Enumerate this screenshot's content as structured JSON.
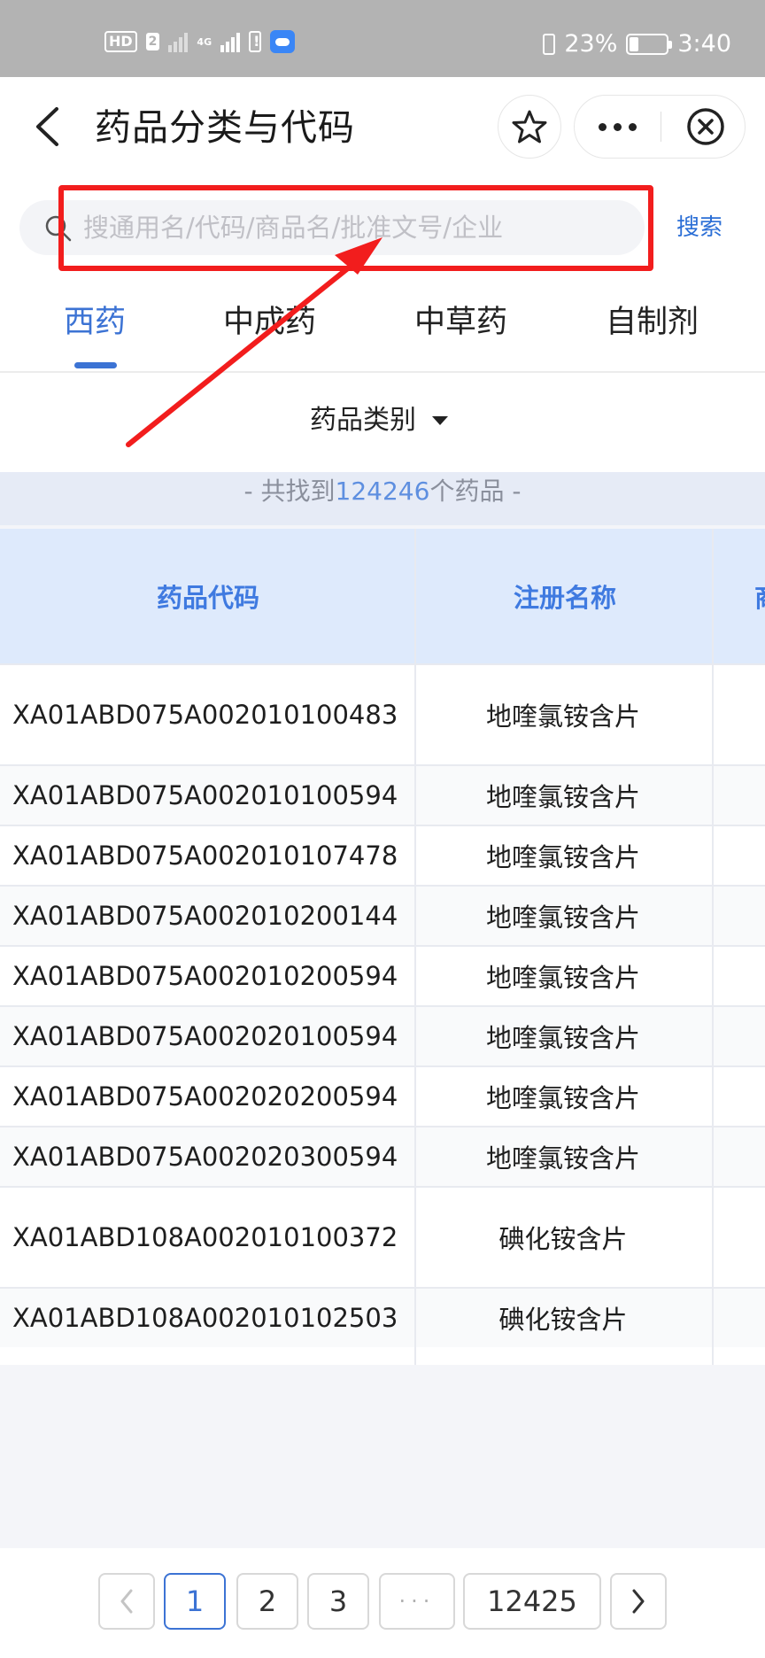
{
  "status_bar": {
    "hd": "HD",
    "sim": "2",
    "network": "4G",
    "battery_percent": "23%",
    "battery_level": 0.23,
    "time": "3:40"
  },
  "header": {
    "title": "药品分类与代码",
    "star_icon": "star-icon",
    "more_icon": "more-dots-icon",
    "close_icon": "close-circle-icon"
  },
  "search": {
    "placeholder": "搜通用名/代码/商品名/批准文号/企业",
    "value": "",
    "button_label": "搜索"
  },
  "tabs": [
    {
      "label": "西药",
      "active": true
    },
    {
      "label": "中成药",
      "active": false
    },
    {
      "label": "中草药",
      "active": false
    },
    {
      "label": "自制剂",
      "active": false
    }
  ],
  "filter": {
    "label": "药品类别"
  },
  "result_count": {
    "prefix": "- 共找到",
    "number": "124246",
    "suffix": "个药品 -"
  },
  "table": {
    "headers": [
      "药品代码",
      "注册名称",
      "商"
    ],
    "rows": [
      {
        "code": "XA01ABD075A002010100483",
        "name": "地喹氯铵含片"
      },
      {
        "code": "XA01ABD075A002010100594",
        "name": "地喹氯铵含片"
      },
      {
        "code": "XA01ABD075A002010107478",
        "name": "地喹氯铵含片"
      },
      {
        "code": "XA01ABD075A002010200144",
        "name": "地喹氯铵含片"
      },
      {
        "code": "XA01ABD075A002010200594",
        "name": "地喹氯铵含片"
      },
      {
        "code": "XA01ABD075A002020100594",
        "name": "地喹氯铵含片"
      },
      {
        "code": "XA01ABD075A002020200594",
        "name": "地喹氯铵含片"
      },
      {
        "code": "XA01ABD075A002020300594",
        "name": "地喹氯铵含片"
      },
      {
        "code": "XA01ABD108A002010100372",
        "name": "碘化铵含片"
      },
      {
        "code": "XA01ABD108A002010102503",
        "name": "碘化铵含片"
      }
    ]
  },
  "pagination": {
    "prev_icon": "chevron-left-icon",
    "pages": [
      "1",
      "2",
      "3"
    ],
    "current": "1",
    "ellipsis": "···",
    "last": "12425",
    "next_icon": "chevron-right-icon"
  },
  "annotation": {
    "highlight_color": "#f21d1d",
    "arrow_color": "#f21d1d"
  },
  "colors": {
    "accent": "#3c73d4",
    "header_bg": "#deeafc"
  }
}
